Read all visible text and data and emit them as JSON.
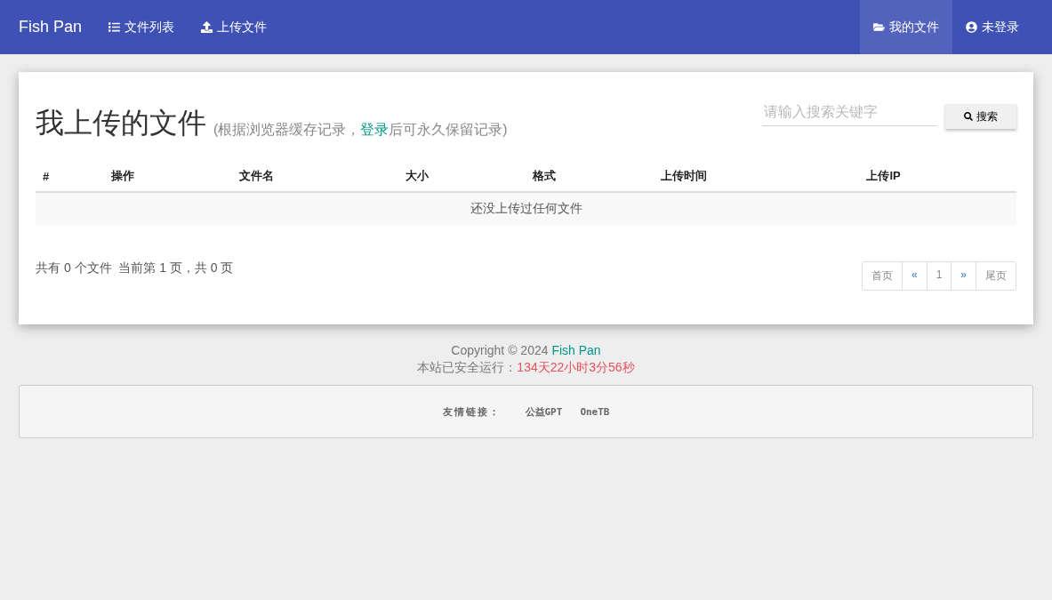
{
  "navbar": {
    "brand": "Fish Pan",
    "left_items": [
      {
        "label": "文件列表",
        "selected": false
      },
      {
        "label": "上传文件",
        "selected": false
      }
    ],
    "right_items": [
      {
        "label": "我的文件",
        "selected": true
      },
      {
        "label": "未登录",
        "selected": false
      }
    ]
  },
  "panel": {
    "title": "我上传的文件",
    "subtitle_before": "(根据浏览器缓存记录，",
    "subtitle_link": "登录",
    "subtitle_after": "后可永久保留记录)",
    "search": {
      "placeholder": "请输入搜索关键字",
      "button": "搜索"
    },
    "table": {
      "columns": [
        "#",
        "操作",
        "文件名",
        "大小",
        "格式",
        "上传时间",
        "上传IP"
      ],
      "empty_message": "还没上传过任何文件"
    },
    "summary": "共有 0 个文件  当前第 1 页，共 0 页",
    "pagination": [
      {
        "label": "首页",
        "disabled": true
      },
      {
        "label": "«",
        "disabled": false
      },
      {
        "label": "1",
        "disabled": true
      },
      {
        "label": "»",
        "disabled": false
      },
      {
        "label": "尾页",
        "disabled": true
      }
    ]
  },
  "footer": {
    "copyright": "Copyright © 2024 ",
    "copyright_link": "Fish Pan",
    "uptime_label": "本站已安全运行：",
    "uptime_value": "134天22小时3分56秒"
  },
  "friend_links": {
    "label": "友情链接：",
    "links": [
      "公益GPT",
      "OneTB"
    ]
  }
}
